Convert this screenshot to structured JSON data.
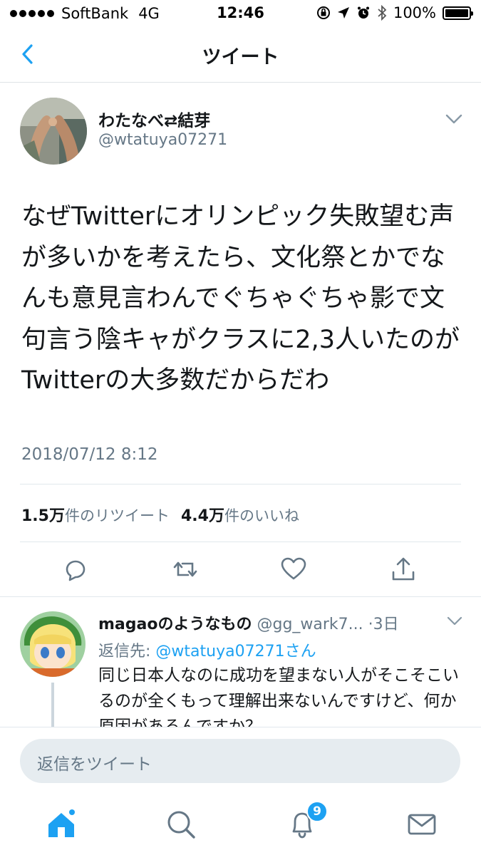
{
  "status_bar": {
    "carrier": "SoftBank",
    "network": "4G",
    "time": "12:46",
    "battery": "100%"
  },
  "nav": {
    "title": "ツイート",
    "back_icon": "chevron-left-icon"
  },
  "tweet": {
    "author_name": "わたなべ⇄結芽",
    "author_handle": "@wtatuya07271",
    "text": "なぜTwitterにオリンピック失敗望む声が多いかを考えたら、文化祭とかでなんも意見言わんでぐちゃぐちゃ影で文句言う陰キャがクラスに2,3人いたのがTwitterの大多数だからだわ",
    "timestamp": "2018/07/12 8:12",
    "retweet_count": "1.5万",
    "retweet_label": "件のリツイート",
    "like_count": "4.4万",
    "like_label": "件のいいね"
  },
  "reply": {
    "name": "magaoのようなもの",
    "handle": "@gg_wark7...",
    "age": "·3日",
    "reply_to_prefix": "返信先: ",
    "reply_to_handle": "@wtatuya07271さん",
    "text": "同じ日本人なのに成功を望まない人がそこそこいるのが全くもって理解出来ないんですけど、何か原因があるんですか？"
  },
  "composer": {
    "placeholder": "返信をツイート"
  },
  "tab_bar": {
    "notification_badge": "9"
  },
  "colors": {
    "accent": "#1da1f2",
    "secondary_text": "#657786",
    "divider": "#e1e8ed"
  }
}
